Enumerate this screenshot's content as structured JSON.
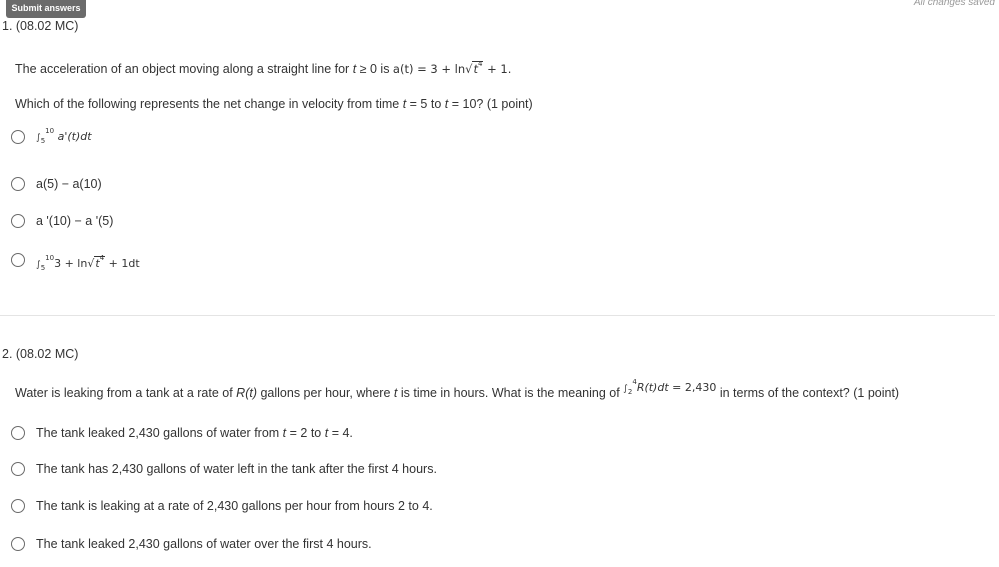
{
  "toolbar": {
    "submit_label": "Submit answers",
    "status": "All changes saved"
  },
  "q1": {
    "header": "1. (08.02 MC)",
    "stem_prefix": "The acceleration of an object moving along a straight line for ",
    "stem_var": "t",
    "stem_cond": " ≥ 0 is ",
    "stem_func": "a(t)",
    "stem_eq": " = 3 + ln",
    "stem_radicand": "t",
    "stem_exp": "4",
    "stem_tail": " + 1.",
    "question_prefix": "Which of the following represents the net change in velocity from time ",
    "question_t1": "t",
    "question_mid": " = 5 to ",
    "question_t2": "t",
    "question_tail": " = 10? (1 point)",
    "options": [
      {
        "int_upper": "10",
        "int_lower": "5",
        "integrand": "a'(t)dt"
      },
      {
        "label": "a(5) − a(10)"
      },
      {
        "label": "a '(10) − a '(5)"
      },
      {
        "int_upper": "10",
        "int_lower": "5",
        "integrand_pre": "3 + ln",
        "radicand": "t",
        "exp": "4",
        "integrand_post": " + 1dt"
      }
    ]
  },
  "q2": {
    "header": "2. (08.02 MC)",
    "stem_prefix": "Water is leaking from a tank at a rate of ",
    "stem_rt": "R(t)",
    "stem_mid1": " gallons per hour, where ",
    "stem_t": "t",
    "stem_mid2": " is time in hours. What is the meaning of ",
    "int_upper": "4",
    "int_lower": "2",
    "integrand": "R(t)dt",
    "int_eq": " = 2,430",
    "stem_tail": " in terms of the context? (1 point)",
    "options": [
      {
        "pre": "The tank leaked 2,430 gallons of water from ",
        "t1": "t",
        "mid": " = 2 to ",
        "t2": "t",
        "post": " = 4."
      },
      {
        "label": "The tank has 2,430 gallons of water left in the tank after the first 4 hours."
      },
      {
        "label": "The tank is leaking at a rate of 2,430 gallons per hour from hours 2 to 4."
      },
      {
        "label": "The tank leaked 2,430 gallons of water over the first 4 hours."
      }
    ]
  }
}
